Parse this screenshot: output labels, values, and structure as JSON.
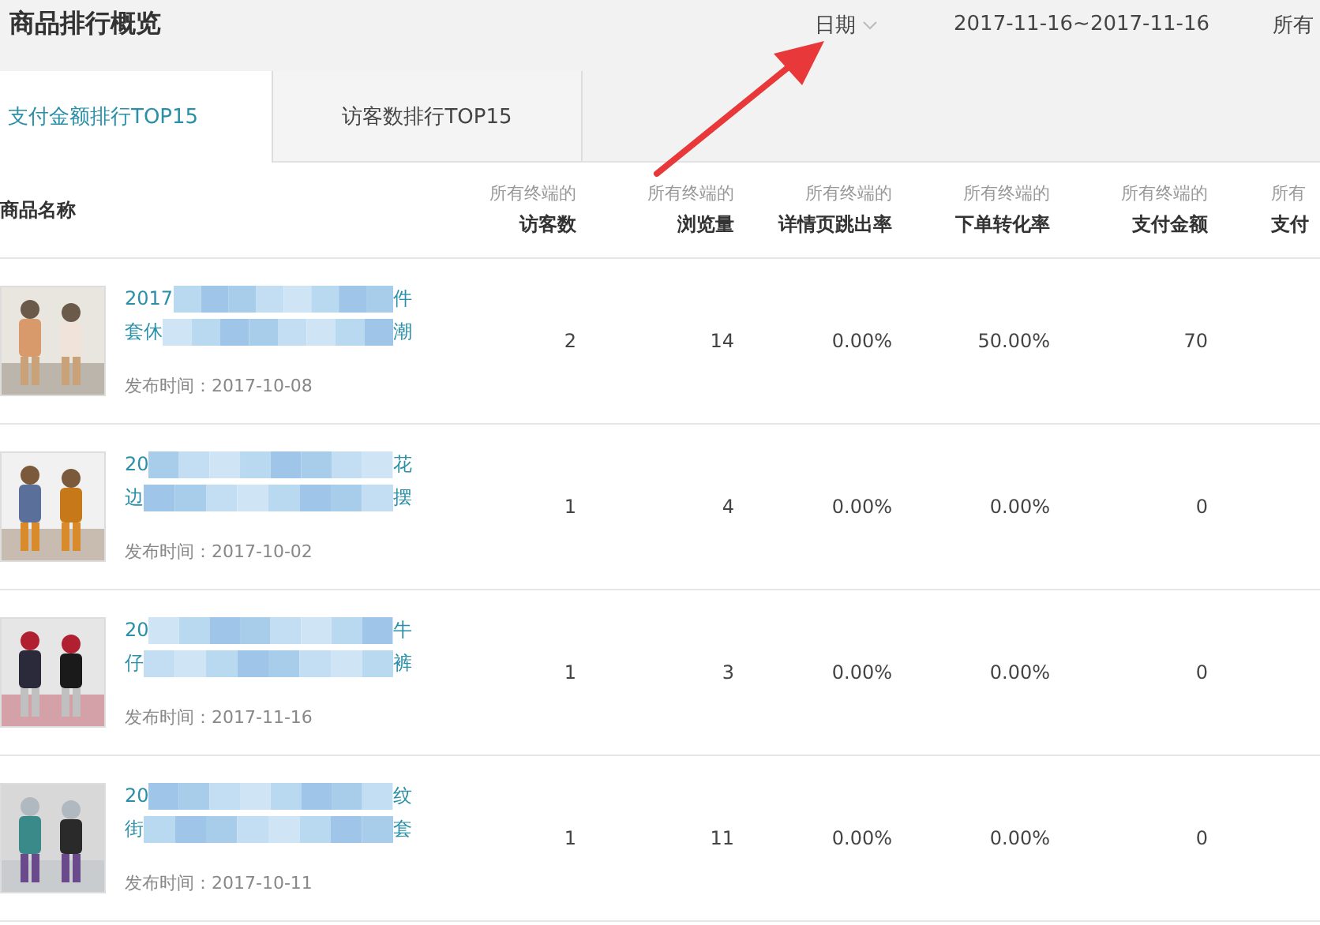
{
  "header": {
    "title": "商品排行概览",
    "date_label": "日期",
    "date_range": "2017-11-16~2017-11-16",
    "cut_label": "所有"
  },
  "tabs": [
    {
      "label": "支付金额排行TOP15",
      "selected": true
    },
    {
      "label": "访客数排行TOP15",
      "selected": false
    }
  ],
  "table": {
    "columns": [
      {
        "name": "商品名称"
      },
      {
        "prefix": "所有终端的",
        "name": "访客数"
      },
      {
        "prefix": "所有终端的",
        "name": "浏览量"
      },
      {
        "prefix": "所有终端的",
        "name": "详情页跳出率"
      },
      {
        "prefix": "所有终端的",
        "name": "下单转化率"
      },
      {
        "prefix": "所有终端的",
        "name": "支付金额"
      },
      {
        "prefix": "所有",
        "name": "支付"
      }
    ],
    "rows": [
      {
        "cells": [
          {
            "title": [
              "2017",
              "件",
              "套休",
              "潮"
            ],
            "published": "发布时间：2017-10-08"
          },
          "2",
          "14",
          "0.00%",
          "50.00%",
          "70"
        ]
      },
      {
        "cells": [
          {
            "title": [
              "20",
              "花",
              "边",
              "摆"
            ],
            "published": "发布时间：2017-10-02"
          },
          "1",
          "4",
          "0.00%",
          "0.00%",
          "0"
        ]
      },
      {
        "cells": [
          {
            "title": [
              "20",
              "牛",
              "仔",
              "裤"
            ],
            "published": "发布时间：2017-11-16"
          },
          "1",
          "3",
          "0.00%",
          "0.00%",
          "0"
        ]
      },
      {
        "cells": [
          {
            "title": [
              "20",
              "纹",
              "街",
              "套"
            ],
            "published": "发布时间：2017-10-11"
          },
          "1",
          "11",
          "0.00%",
          "0.00%",
          "0"
        ]
      }
    ]
  }
}
